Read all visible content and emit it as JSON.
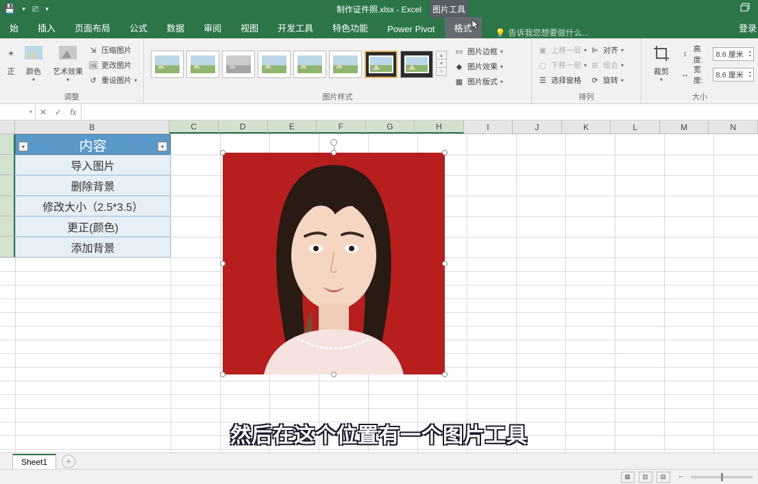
{
  "title": {
    "doc": "制作证件照.xlsx - Excel",
    "context_tab": "图片工具"
  },
  "tabs": {
    "t0": "始",
    "t1": "插入",
    "t2": "页面布局",
    "t3": "公式",
    "t4": "数据",
    "t5": "审阅",
    "t6": "视图",
    "t7": "开发工具",
    "t8": "特色功能",
    "t9": "Power Pivot",
    "t10": "格式",
    "tell_me": "告诉我您想要做什么...",
    "login": "登录"
  },
  "ribbon": {
    "adjust": {
      "correct": "正",
      "color": "颜色",
      "art": "艺术效果",
      "compress": "压缩图片",
      "change": "更改图片",
      "reset": "重设图片",
      "group_label": "调整"
    },
    "styles": {
      "group_label": "图片样式",
      "border": "图片边框",
      "effects": "图片效果",
      "layout": "图片版式"
    },
    "arrange": {
      "group_label": "排列",
      "bring_fwd": "上移一层",
      "send_back": "下移一层",
      "selection_pane": "选择窗格",
      "align": "对齐",
      "group": "组合",
      "rotate": "旋转"
    },
    "size": {
      "group_label": "大小",
      "crop": "裁剪",
      "height_label": "高度:",
      "height_val": "8.6 厘米",
      "width_label": "宽度:",
      "width_val": "8.6 厘米"
    }
  },
  "formula": {
    "name": "",
    "fx": "fx"
  },
  "columns": [
    "B",
    "C",
    "D",
    "E",
    "F",
    "G",
    "H",
    "I",
    "J",
    "K",
    "L",
    "M",
    "N"
  ],
  "col_widths": {
    "A": 22,
    "B": 227,
    "other": 72
  },
  "cells": {
    "header": "内容",
    "r2": "导入图片",
    "r3": "删除背景",
    "r4": "修改大小（2.5*3.5）",
    "r5": "更正(颜色)",
    "r6": "添加背景"
  },
  "sheet_tab": "Sheet1",
  "subtitle": "然后在这个位置有一个图片工具"
}
